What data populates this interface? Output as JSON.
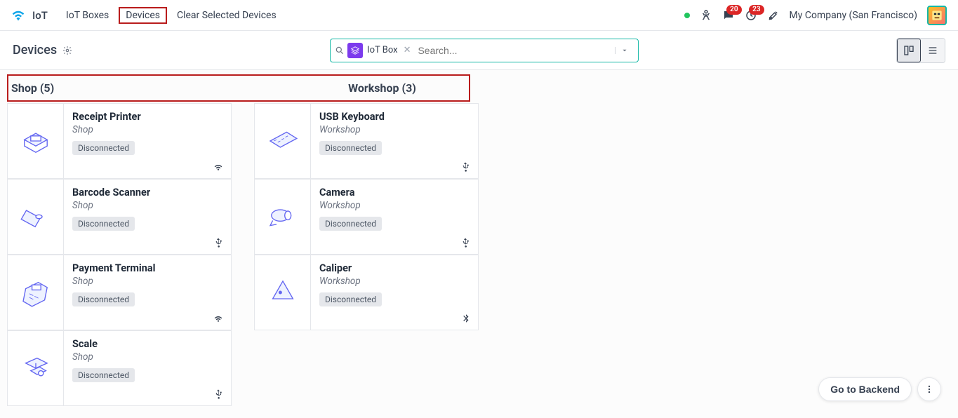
{
  "header": {
    "app_name": "IoT",
    "nav": [
      "IoT Boxes",
      "Devices",
      "Clear Selected Devices"
    ],
    "active_nav_index": 1,
    "company": "My Company (San Francisco)",
    "notifications": {
      "messages_badge": "20",
      "activities_badge": "23"
    }
  },
  "control": {
    "page_title": "Devices",
    "search_placeholder": "Search...",
    "search_chip": "IoT Box"
  },
  "groups": [
    {
      "title": "Shop (5)",
      "location": "Shop",
      "devices": [
        {
          "name": "Receipt Printer",
          "status": "Disconnected",
          "conn": "wifi",
          "icon": "printer"
        },
        {
          "name": "Barcode Scanner",
          "status": "Disconnected",
          "conn": "usb",
          "icon": "scanner"
        },
        {
          "name": "Payment Terminal",
          "status": "Disconnected",
          "conn": "wifi",
          "icon": "terminal"
        },
        {
          "name": "Scale",
          "status": "Disconnected",
          "conn": "usb",
          "icon": "scale"
        }
      ]
    },
    {
      "title": "Workshop (3)",
      "location": "Workshop",
      "devices": [
        {
          "name": "USB Keyboard",
          "status": "Disconnected",
          "conn": "usb",
          "icon": "keyboard"
        },
        {
          "name": "Camera",
          "status": "Disconnected",
          "conn": "usb",
          "icon": "camera"
        },
        {
          "name": "Caliper",
          "status": "Disconnected",
          "conn": "bluetooth",
          "icon": "caliper"
        }
      ]
    }
  ],
  "floating": {
    "go_backend": "Go to Backend"
  }
}
